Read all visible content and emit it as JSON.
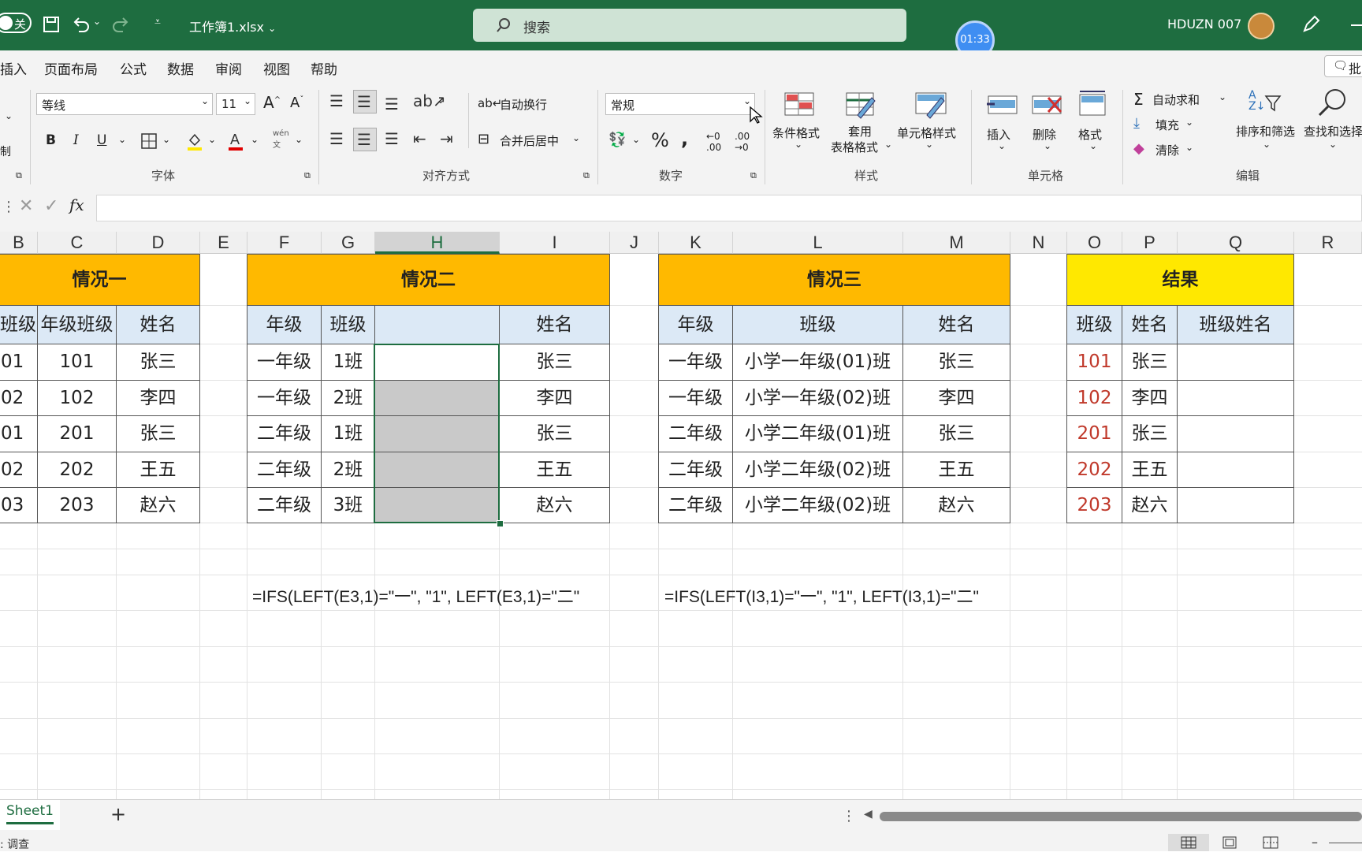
{
  "titlebar": {
    "autosave_state": "关",
    "filename": "工作簿1.xlsx",
    "search_placeholder": "搜索",
    "timer": "01:33",
    "user": "HDUZN 007"
  },
  "menu": [
    "插入",
    "页面布局",
    "公式",
    "数据",
    "审阅",
    "视图",
    "帮助"
  ],
  "comments_label": "批",
  "ribbon": {
    "font_name": "等线",
    "font_size": "11",
    "number_format": "常规",
    "wrap_text": "自动换行",
    "merge_center": "合并后居中",
    "cond_format": "条件格式",
    "table_format_1": "套用",
    "table_format_2": "表格格式",
    "cell_styles": "单元格样式",
    "insert": "插入",
    "delete": "删除",
    "format": "格式",
    "autosum": "自动求和",
    "fill": "填充",
    "clear": "清除",
    "sort_filter": "排序和筛选",
    "find_select": "查找和选择",
    "groups": {
      "font": "字体",
      "alignment": "对齐方式",
      "number": "数字",
      "styles": "样式",
      "cells": "单元格",
      "editing": "编辑"
    },
    "clipboard_partial": "制"
  },
  "columns": [
    "B",
    "C",
    "D",
    "E",
    "F",
    "G",
    "H",
    "I",
    "J",
    "K",
    "L",
    "M",
    "N",
    "O",
    "P",
    "Q",
    "R"
  ],
  "selected_column": "H",
  "table1": {
    "title": "情况一",
    "headers": [
      "班级",
      "年级班级",
      "姓名"
    ],
    "rows": [
      [
        "01",
        "101",
        "张三"
      ],
      [
        "02",
        "102",
        "李四"
      ],
      [
        "01",
        "201",
        "张三"
      ],
      [
        "02",
        "202",
        "王五"
      ],
      [
        "03",
        "203",
        "赵六"
      ]
    ]
  },
  "table2": {
    "title": "情况二",
    "headers": [
      "年级",
      "班级",
      "",
      "姓名"
    ],
    "rows": [
      [
        "一年级",
        "1班",
        "",
        "张三"
      ],
      [
        "一年级",
        "2班",
        "",
        "李四"
      ],
      [
        "二年级",
        "1班",
        "",
        "张三"
      ],
      [
        "二年级",
        "2班",
        "",
        "王五"
      ],
      [
        "二年级",
        "3班",
        "",
        "赵六"
      ]
    ]
  },
  "table3": {
    "title": "情况三",
    "headers": [
      "年级",
      "班级",
      "姓名"
    ],
    "rows": [
      [
        "一年级",
        "小学一年级(01)班",
        "张三"
      ],
      [
        "一年级",
        "小学一年级(02)班",
        "李四"
      ],
      [
        "二年级",
        "小学二年级(01)班",
        "张三"
      ],
      [
        "二年级",
        "小学二年级(02)班",
        "王五"
      ],
      [
        "二年级",
        "小学二年级(02)班",
        "赵六"
      ]
    ]
  },
  "table4": {
    "title": "结果",
    "headers": [
      "班级",
      "姓名",
      "班级姓名"
    ],
    "rows": [
      [
        "101",
        "张三",
        ""
      ],
      [
        "102",
        "李四",
        ""
      ],
      [
        "201",
        "张三",
        ""
      ],
      [
        "202",
        "王五",
        ""
      ],
      [
        "203",
        "赵六",
        ""
      ]
    ]
  },
  "formula1": "=IFS(LEFT(E3,1)=\"一\", \"1\", LEFT(E3,1)=\"二\"",
  "formula2": "=IFS(LEFT(I3,1)=\"一\", \"1\", LEFT(I3,1)=\"二\"",
  "sheet_tab": "Sheet1",
  "status_text": ": 调查",
  "colors": {
    "title_bar": "#1e6d40",
    "header_orange": "#ffb900",
    "header_yellow": "#ffe800",
    "header_blue": "#dce9f6",
    "result_red": "#c0392b"
  }
}
